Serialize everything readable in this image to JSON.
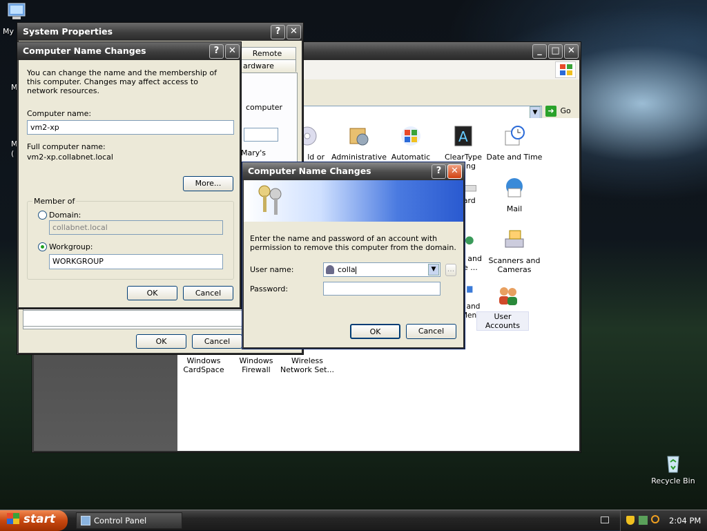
{
  "desktop": {
    "my_computer_label": "My",
    "left_labels": [
      "M",
      "M",
      "("
    ],
    "recycle_bin_label": "Recycle Bin"
  },
  "system_properties": {
    "title": "System Properties",
    "tabs": [
      "Remote",
      "ardware"
    ],
    "fragments": [
      "computer",
      "Mary's"
    ],
    "ok_label": "OK",
    "cancel_label": "Cancel"
  },
  "control_panel": {
    "address_go_label": "Go",
    "items": [
      {
        "label": "ld or",
        "icon": "cd-sound-icon"
      },
      {
        "label": "Administrative Tools",
        "icon": "admin-tools-icon"
      },
      {
        "label": "Automatic Updates",
        "icon": "windows-update-icon"
      },
      {
        "label": "ClearType Tuning",
        "icon": "cleartype-icon"
      },
      {
        "label": "Date and Time",
        "icon": "clock-icon"
      },
      {
        "label": "oard",
        "icon": "keyboard-icon"
      },
      {
        "label": "Mail",
        "icon": "mail-icon"
      },
      {
        "label": "al and ge ...",
        "icon": "globe-icon"
      },
      {
        "label": "Scanners and Cameras",
        "icon": "scanner-icon"
      },
      {
        "label": "r and Men",
        "icon": "taskbar-icon"
      },
      {
        "label": "User Accounts",
        "icon": "users-icon"
      },
      {
        "label": "Windows CardSpace",
        "icon": "cardspace-icon"
      },
      {
        "label": "Windows Firewall",
        "icon": "firewall-icon"
      },
      {
        "label": "Wireless Network Set...",
        "icon": "wireless-icon"
      }
    ]
  },
  "name_changes": {
    "title": "Computer Name Changes",
    "intro": "You can change the name and the membership of this computer. Changes may affect access to network resources.",
    "computer_name_label": "Computer name:",
    "computer_name_value": "vm2-xp",
    "full_name_label": "Full computer name:",
    "full_name_value": "vm2-xp.collabnet.local",
    "more_label": "More...",
    "member_of_label": "Member of",
    "domain_label": "Domain:",
    "domain_value": "collabnet.local",
    "workgroup_label": "Workgroup:",
    "workgroup_value": "WORKGROUP",
    "ok_label": "OK",
    "cancel_label": "Cancel"
  },
  "credentials": {
    "title": "Computer Name Changes",
    "prompt": "Enter the name and password of an account with permission to remove this computer from the domain.",
    "user_label": "User name:",
    "user_value": "colla",
    "password_label": "Password:",
    "password_value": "",
    "browse_label": "...",
    "ok_label": "OK",
    "cancel_label": "Cancel"
  },
  "taskbar": {
    "start_label": "start",
    "task_label": "Control Panel",
    "clock": "2:04 PM"
  }
}
